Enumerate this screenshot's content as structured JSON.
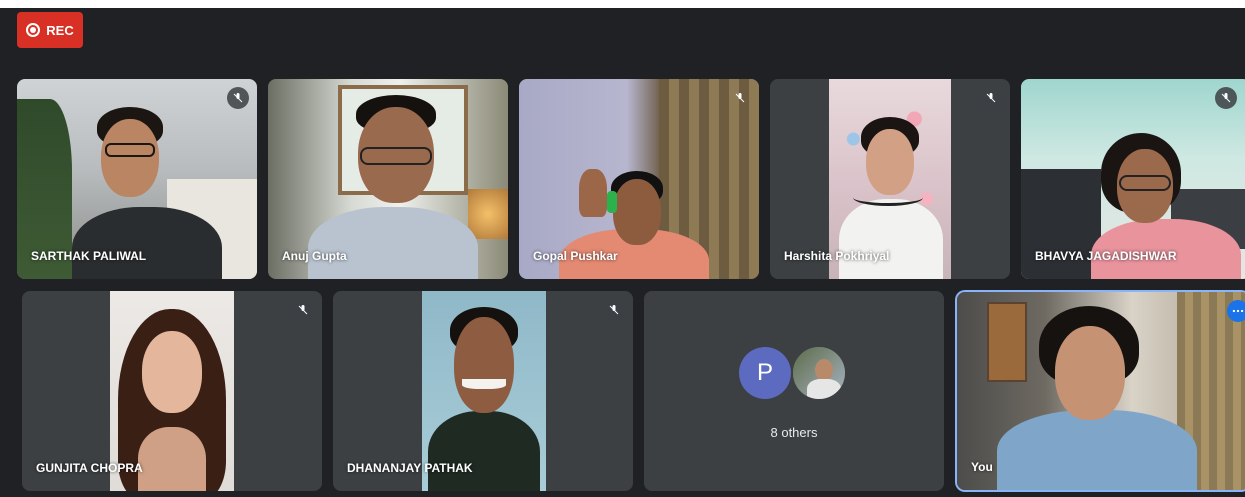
{
  "recording": {
    "label": "REC",
    "color": "#d93025"
  },
  "participants_row1": [
    {
      "name": "SARTHAK PALIWAL",
      "muted": true,
      "icon": "mic-off-icon"
    },
    {
      "name": "Anuj Gupta",
      "muted": false,
      "icon": "mic-off-icon"
    },
    {
      "name": "Gopal Pushkar",
      "muted": true,
      "icon": "mic-off-icon"
    },
    {
      "name": "Harshita Pokhriyal",
      "muted": true,
      "icon": "mic-off-icon"
    },
    {
      "name": "BHAVYA JAGADISHWAR",
      "muted": true,
      "icon": "mic-off-icon"
    }
  ],
  "participants_row2": [
    {
      "name": "GUNJITA CHOPRA",
      "muted": true,
      "icon": "mic-off-icon"
    },
    {
      "name": "DHANANJAY PATHAK",
      "muted": true,
      "icon": "mic-off-icon"
    }
  ],
  "others": {
    "avatar_letter": "P",
    "label": "8 others",
    "avatar_color": "#5c6bc0"
  },
  "self": {
    "name": "You",
    "more_icon": "more-options-icon",
    "highlight_color": "#8ab4f8"
  },
  "theme": {
    "background": "#202124",
    "tile": "#3c4043"
  }
}
